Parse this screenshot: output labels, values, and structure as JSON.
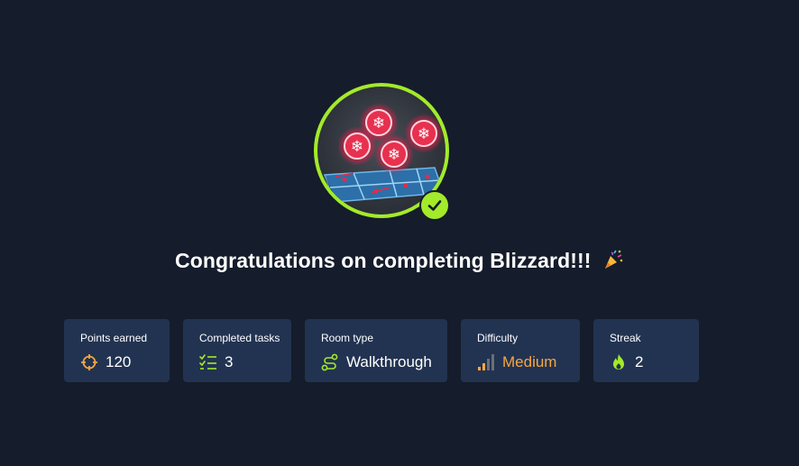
{
  "room": {
    "name": "Blizzard",
    "completed": true
  },
  "title": "Congratulations on completing Blizzard!!!",
  "title_emoji_icon": "party-popper-icon",
  "stats": {
    "points": {
      "label": "Points earned",
      "value": "120",
      "icon": "crosshair-icon",
      "color": "#f5a742"
    },
    "tasks": {
      "label": "Completed tasks",
      "value": "3",
      "icon": "checklist-icon",
      "color": "#a3ea2a"
    },
    "room_type": {
      "label": "Room type",
      "value": "Walkthrough",
      "icon": "route-icon",
      "color": "#a3ea2a"
    },
    "difficulty": {
      "label": "Difficulty",
      "value": "Medium",
      "icon": "signal-bars-icon",
      "color": "#f5a742"
    },
    "streak": {
      "label": "Streak",
      "value": "2",
      "icon": "flame-icon",
      "color": "#a3ea2a"
    }
  },
  "colors": {
    "background": "#151c2b",
    "card": "#223351",
    "accent_green": "#a3ea2a",
    "accent_orange": "#f5a742"
  }
}
